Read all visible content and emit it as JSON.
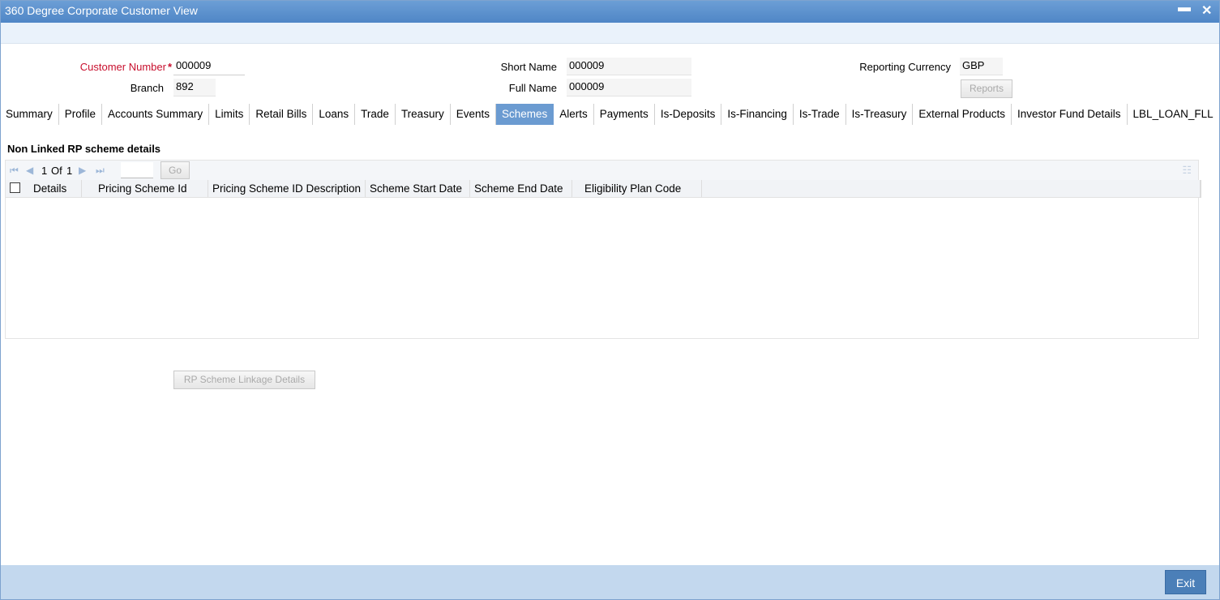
{
  "window": {
    "title": "360 Degree Corporate Customer View",
    "minimize_glyph": "▬",
    "close_glyph": "✕"
  },
  "form": {
    "customer_number_label": "Customer Number",
    "required_mark": "*",
    "customer_number_value": "000009",
    "branch_label": "Branch",
    "branch_value": "892",
    "short_name_label": "Short Name",
    "short_name_value": "000009",
    "full_name_label": "Full Name",
    "full_name_value": "000009",
    "reporting_currency_label": "Reporting Currency",
    "reporting_currency_value": "GBP",
    "reports_button": "Reports"
  },
  "tabs": [
    {
      "label": "Summary",
      "active": false
    },
    {
      "label": "Profile",
      "active": false
    },
    {
      "label": "Accounts Summary",
      "active": false
    },
    {
      "label": "Limits",
      "active": false
    },
    {
      "label": "Retail Bills",
      "active": false
    },
    {
      "label": "Loans",
      "active": false
    },
    {
      "label": "Trade",
      "active": false
    },
    {
      "label": "Treasury",
      "active": false
    },
    {
      "label": "Events",
      "active": false
    },
    {
      "label": "Schemes",
      "active": true
    },
    {
      "label": "Alerts",
      "active": false
    },
    {
      "label": "Payments",
      "active": false
    },
    {
      "label": "Is-Deposits",
      "active": false
    },
    {
      "label": "Is-Financing",
      "active": false
    },
    {
      "label": "Is-Trade",
      "active": false
    },
    {
      "label": "Is-Treasury",
      "active": false
    },
    {
      "label": "External Products",
      "active": false
    },
    {
      "label": "Investor Fund Details",
      "active": false
    },
    {
      "label": "LBL_LOAN_FLL",
      "active": false
    }
  ],
  "section": {
    "title": "Non Linked RP scheme details",
    "pager": {
      "current": "1",
      "of_label": "Of",
      "total": "1",
      "go_label": "Go"
    },
    "columns": [
      "Details",
      "Pricing Scheme Id",
      "Pricing Scheme ID Description",
      "Scheme Start Date",
      "Scheme End Date",
      "Eligibility Plan Code"
    ]
  },
  "rp_linkage_button": "RP Scheme Linkage Details",
  "footer": {
    "exit_label": "Exit"
  },
  "colors": {
    "titlebar": "#5b8fcb",
    "active_tab": "#6b9bd1",
    "required_label": "#c8102e",
    "footer": "#c3d8ee",
    "exit_button": "#4b7fb8"
  }
}
